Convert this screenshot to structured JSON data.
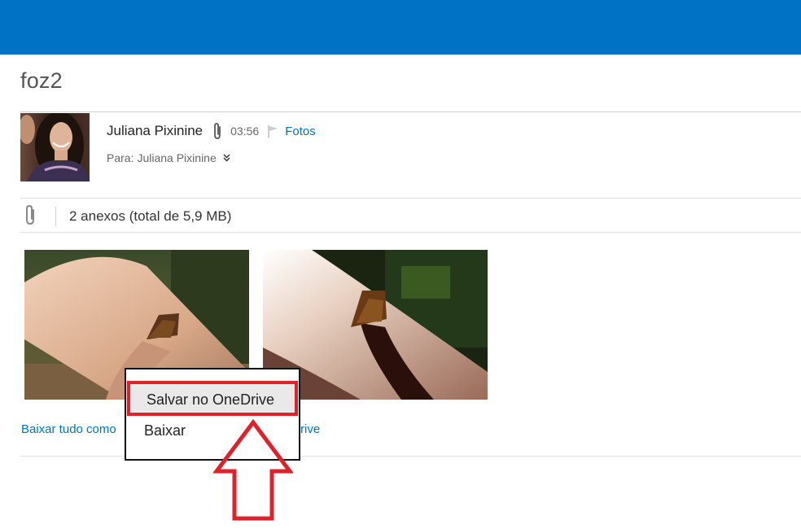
{
  "subject": "foz2",
  "message": {
    "sender": "Juliana Pixinine",
    "time": "03:56",
    "folder": "Fotos",
    "to_label": "Para:",
    "to_name": "Juliana Pixinine"
  },
  "attachments": {
    "summary": "2 anexos (total de 5,9 MB)",
    "download_all_link": "Baixar tudo como",
    "onedrive_link_fragment": "rive"
  },
  "context_menu": {
    "items": [
      {
        "label": "Salvar no OneDrive",
        "highlighted": true
      },
      {
        "label": "Baixar",
        "highlighted": false
      }
    ]
  },
  "icons": {
    "attachment": "paperclip-icon",
    "flag": "flag-icon",
    "expand": "double-chevron-down-icon",
    "annotation": "up-arrow-outline"
  },
  "colors": {
    "header": "#0072c6",
    "link": "#0072c6",
    "highlight_border": "#e0202a",
    "menu_highlight_bg": "#e9e9e9"
  }
}
